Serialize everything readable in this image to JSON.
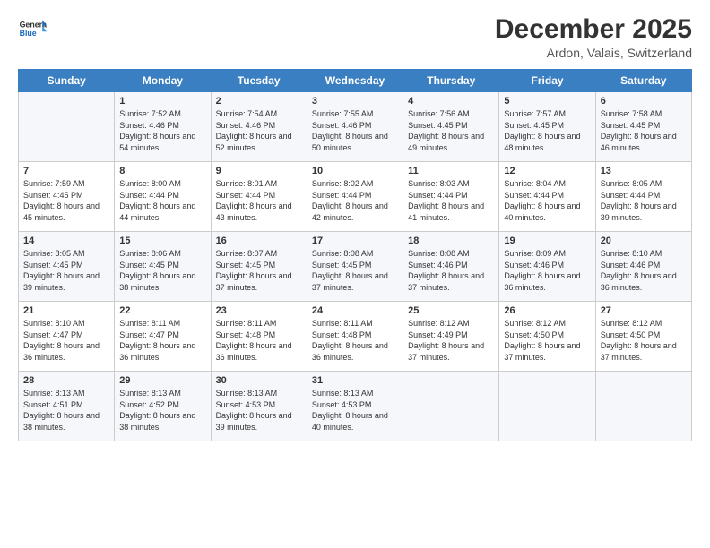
{
  "logo": {
    "general": "General",
    "blue": "Blue"
  },
  "header": {
    "month": "December 2025",
    "location": "Ardon, Valais, Switzerland"
  },
  "days_of_week": [
    "Sunday",
    "Monday",
    "Tuesday",
    "Wednesday",
    "Thursday",
    "Friday",
    "Saturday"
  ],
  "weeks": [
    [
      {
        "day": null,
        "data": null
      },
      {
        "day": "1",
        "sunrise": "7:52 AM",
        "sunset": "4:46 PM",
        "daylight": "8 hours and 54 minutes."
      },
      {
        "day": "2",
        "sunrise": "7:54 AM",
        "sunset": "4:46 PM",
        "daylight": "8 hours and 52 minutes."
      },
      {
        "day": "3",
        "sunrise": "7:55 AM",
        "sunset": "4:46 PM",
        "daylight": "8 hours and 50 minutes."
      },
      {
        "day": "4",
        "sunrise": "7:56 AM",
        "sunset": "4:45 PM",
        "daylight": "8 hours and 49 minutes."
      },
      {
        "day": "5",
        "sunrise": "7:57 AM",
        "sunset": "4:45 PM",
        "daylight": "8 hours and 48 minutes."
      },
      {
        "day": "6",
        "sunrise": "7:58 AM",
        "sunset": "4:45 PM",
        "daylight": "8 hours and 46 minutes."
      }
    ],
    [
      {
        "day": "7",
        "sunrise": "7:59 AM",
        "sunset": "4:45 PM",
        "daylight": "8 hours and 45 minutes."
      },
      {
        "day": "8",
        "sunrise": "8:00 AM",
        "sunset": "4:44 PM",
        "daylight": "8 hours and 44 minutes."
      },
      {
        "day": "9",
        "sunrise": "8:01 AM",
        "sunset": "4:44 PM",
        "daylight": "8 hours and 43 minutes."
      },
      {
        "day": "10",
        "sunrise": "8:02 AM",
        "sunset": "4:44 PM",
        "daylight": "8 hours and 42 minutes."
      },
      {
        "day": "11",
        "sunrise": "8:03 AM",
        "sunset": "4:44 PM",
        "daylight": "8 hours and 41 minutes."
      },
      {
        "day": "12",
        "sunrise": "8:04 AM",
        "sunset": "4:44 PM",
        "daylight": "8 hours and 40 minutes."
      },
      {
        "day": "13",
        "sunrise": "8:05 AM",
        "sunset": "4:44 PM",
        "daylight": "8 hours and 39 minutes."
      }
    ],
    [
      {
        "day": "14",
        "sunrise": "8:05 AM",
        "sunset": "4:45 PM",
        "daylight": "8 hours and 39 minutes."
      },
      {
        "day": "15",
        "sunrise": "8:06 AM",
        "sunset": "4:45 PM",
        "daylight": "8 hours and 38 minutes."
      },
      {
        "day": "16",
        "sunrise": "8:07 AM",
        "sunset": "4:45 PM",
        "daylight": "8 hours and 37 minutes."
      },
      {
        "day": "17",
        "sunrise": "8:08 AM",
        "sunset": "4:45 PM",
        "daylight": "8 hours and 37 minutes."
      },
      {
        "day": "18",
        "sunrise": "8:08 AM",
        "sunset": "4:46 PM",
        "daylight": "8 hours and 37 minutes."
      },
      {
        "day": "19",
        "sunrise": "8:09 AM",
        "sunset": "4:46 PM",
        "daylight": "8 hours and 36 minutes."
      },
      {
        "day": "20",
        "sunrise": "8:10 AM",
        "sunset": "4:46 PM",
        "daylight": "8 hours and 36 minutes."
      }
    ],
    [
      {
        "day": "21",
        "sunrise": "8:10 AM",
        "sunset": "4:47 PM",
        "daylight": "8 hours and 36 minutes."
      },
      {
        "day": "22",
        "sunrise": "8:11 AM",
        "sunset": "4:47 PM",
        "daylight": "8 hours and 36 minutes."
      },
      {
        "day": "23",
        "sunrise": "8:11 AM",
        "sunset": "4:48 PM",
        "daylight": "8 hours and 36 minutes."
      },
      {
        "day": "24",
        "sunrise": "8:11 AM",
        "sunset": "4:48 PM",
        "daylight": "8 hours and 36 minutes."
      },
      {
        "day": "25",
        "sunrise": "8:12 AM",
        "sunset": "4:49 PM",
        "daylight": "8 hours and 37 minutes."
      },
      {
        "day": "26",
        "sunrise": "8:12 AM",
        "sunset": "4:50 PM",
        "daylight": "8 hours and 37 minutes."
      },
      {
        "day": "27",
        "sunrise": "8:12 AM",
        "sunset": "4:50 PM",
        "daylight": "8 hours and 37 minutes."
      }
    ],
    [
      {
        "day": "28",
        "sunrise": "8:13 AM",
        "sunset": "4:51 PM",
        "daylight": "8 hours and 38 minutes."
      },
      {
        "day": "29",
        "sunrise": "8:13 AM",
        "sunset": "4:52 PM",
        "daylight": "8 hours and 38 minutes."
      },
      {
        "day": "30",
        "sunrise": "8:13 AM",
        "sunset": "4:53 PM",
        "daylight": "8 hours and 39 minutes."
      },
      {
        "day": "31",
        "sunrise": "8:13 AM",
        "sunset": "4:53 PM",
        "daylight": "8 hours and 40 minutes."
      },
      {
        "day": null,
        "data": null
      },
      {
        "day": null,
        "data": null
      },
      {
        "day": null,
        "data": null
      }
    ]
  ],
  "labels": {
    "sunrise": "Sunrise:",
    "sunset": "Sunset:",
    "daylight": "Daylight:"
  }
}
